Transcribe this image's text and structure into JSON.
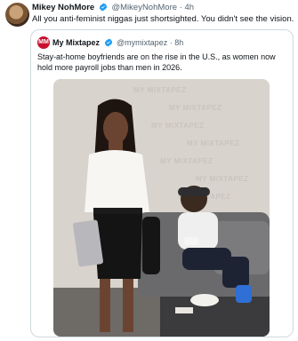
{
  "tweet": {
    "author_name": "Mikey NohMore",
    "handle": "@MikeyNohMore",
    "time": "4h",
    "separator": "·",
    "text": "All you anti-feminist niggas just shortsighted. You didn't see the vision."
  },
  "quoted": {
    "author_name": "My Mixtapez",
    "handle": "@mymixtapez",
    "time": "8h",
    "separator": "·",
    "avatar_text": "MM",
    "text": "Stay-at-home boyfriends are on the rise in the U.S., as women now hold more payroll jobs than men in 2026.",
    "watermark": "MY MIXTAPEZ"
  },
  "colors": {
    "verified": "#1d9bf0",
    "muted": "#536471",
    "border": "#cfd9de"
  }
}
